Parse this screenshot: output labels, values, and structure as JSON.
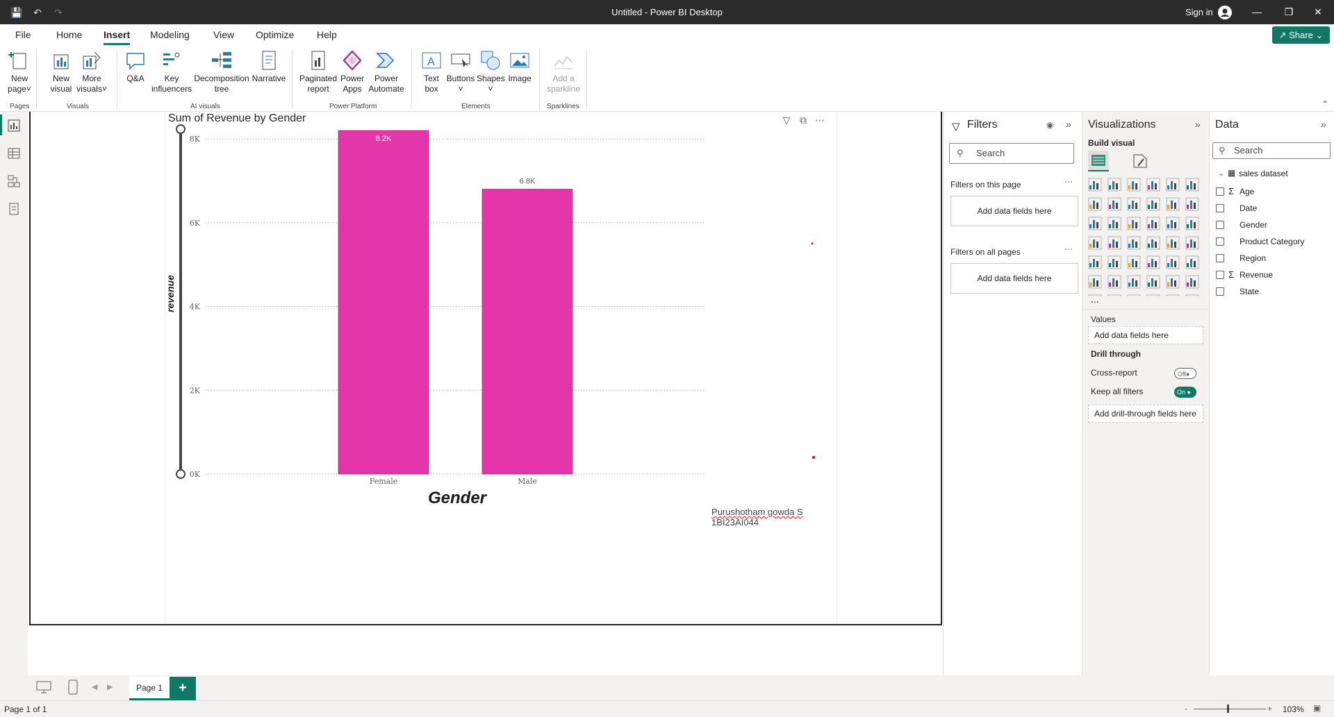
{
  "window": {
    "title": "Untitled - Power BI Desktop",
    "sign_in": "Sign in"
  },
  "menu": {
    "tabs": [
      "File",
      "Home",
      "Insert",
      "Modeling",
      "View",
      "Optimize",
      "Help"
    ],
    "active": "Insert",
    "share": "Share"
  },
  "ribbon": {
    "new_page": [
      "New",
      "page"
    ],
    "new_visual": [
      "New",
      "visual"
    ],
    "more_visuals": [
      "More",
      "visuals"
    ],
    "qa": "Q&A",
    "key_influencers": [
      "Key",
      "influencers"
    ],
    "decomposition_tree": [
      "Decomposition",
      "tree"
    ],
    "narrative": "Narrative",
    "paginated_report": [
      "Paginated",
      "report"
    ],
    "power_apps": [
      "Power",
      "Apps"
    ],
    "power_automate": [
      "Power",
      "Automate"
    ],
    "text_box": [
      "Text",
      "box"
    ],
    "buttons": "Buttons",
    "shapes": "Shapes",
    "image": "Image",
    "add_sparkline": [
      "Add a",
      "sparkline"
    ],
    "groups": {
      "pages": "Pages",
      "visuals": "Visuals",
      "ai_visuals": "AI visuals",
      "power_platform": "Power Platform",
      "elements": "Elements",
      "sparklines": "Sparklines"
    }
  },
  "chart_data": {
    "type": "bar",
    "title": "Sum of Revenue by Gender",
    "xlabel": "Gender",
    "ylabel": "revenue",
    "categories": [
      "Female",
      "Male"
    ],
    "values": [
      8200,
      6800
    ],
    "data_labels": [
      "8.2K",
      "6.8K"
    ],
    "ylim": [
      0,
      8200
    ],
    "yticks": [
      0,
      2000,
      4000,
      6000,
      8000
    ],
    "ytick_labels": [
      "0K",
      "2K",
      "4K",
      "6K",
      "8K"
    ],
    "grid": true,
    "bar_color": "#e535ab"
  },
  "annotation": {
    "line1": "Purushotham gowda S",
    "line2": "1BI23AI044"
  },
  "pages": {
    "tab": "Page 1"
  },
  "status": {
    "page_info": "Page 1 of 1",
    "zoom": "103%"
  },
  "filters": {
    "title": "Filters",
    "search_placeholder": "Search",
    "on_this_page": "Filters on this page",
    "on_all_pages": "Filters on all pages",
    "add_fields": "Add data fields here"
  },
  "visualizations": {
    "title": "Visualizations",
    "build_visual": "Build visual",
    "more": "...",
    "values_label": "Values",
    "values_drop": "Add data fields here",
    "drill_through": "Drill through",
    "cross_report": "Cross-report",
    "cross_report_state": "Off",
    "keep_all_filters": "Keep all filters",
    "keep_all_state": "On",
    "drill_drop": "Add drill-through fields here"
  },
  "data": {
    "title": "Data",
    "search_placeholder": "Search",
    "dataset": "sales dataset",
    "fields": [
      {
        "name": "Age",
        "sigma": true
      },
      {
        "name": "Date",
        "sigma": false
      },
      {
        "name": "Gender",
        "sigma": false
      },
      {
        "name": "Product Category",
        "sigma": false
      },
      {
        "name": "Region",
        "sigma": false
      },
      {
        "name": "Revenue",
        "sigma": true
      },
      {
        "name": "State",
        "sigma": false
      }
    ]
  },
  "colors": {
    "accent": "#117865",
    "bar": "#e535ab",
    "titlebar": "#2b2b2b"
  }
}
